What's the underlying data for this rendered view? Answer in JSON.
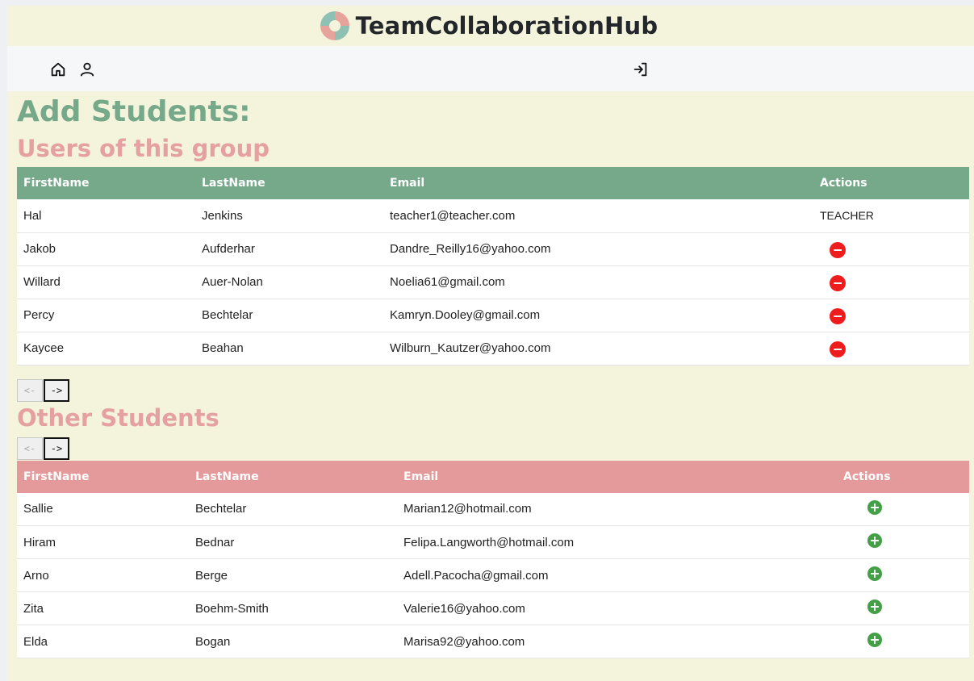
{
  "app": {
    "title": "TeamCollaborationHub"
  },
  "nav": {
    "home_icon": "home-icon",
    "user_icon": "user-icon",
    "login_icon": "login-icon"
  },
  "page": {
    "title": "Add Students:"
  },
  "group": {
    "title": "Users of this group",
    "columns": [
      "FirstName",
      "LastName",
      "Email",
      "Actions"
    ],
    "rows": [
      {
        "first": "Hal",
        "last": "Jenkins",
        "email": "teacher1@teacher.com",
        "action": "TEACHER"
      },
      {
        "first": "Jakob",
        "last": "Aufderhar",
        "email": "Dandre_Reilly16@yahoo.com",
        "action": "remove"
      },
      {
        "first": "Willard",
        "last": "Auer-Nolan",
        "email": "Noelia61@gmail.com",
        "action": "remove"
      },
      {
        "first": "Percy",
        "last": "Bechtelar",
        "email": "Kamryn.Dooley@gmail.com",
        "action": "remove"
      },
      {
        "first": "Kaycee",
        "last": "Beahan",
        "email": "Wilburn_Kautzer@yahoo.com",
        "action": "remove"
      }
    ],
    "pager": {
      "prev": "<-",
      "next": "->"
    }
  },
  "others": {
    "title": "Other Students",
    "columns": [
      "FirstName",
      "LastName",
      "Email",
      "Actions"
    ],
    "rows": [
      {
        "first": "Sallie",
        "last": "Bechtelar",
        "email": "Marian12@hotmail.com",
        "action": "add"
      },
      {
        "first": "Hiram",
        "last": "Bednar",
        "email": "Felipa.Langworth@hotmail.com",
        "action": "add"
      },
      {
        "first": "Arno",
        "last": "Berge",
        "email": "Adell.Pacocha@gmail.com",
        "action": "add"
      },
      {
        "first": "Zita",
        "last": "Boehm-Smith",
        "email": "Valerie16@yahoo.com",
        "action": "add"
      },
      {
        "first": "Elda",
        "last": "Bogan",
        "email": "Marisa92@yahoo.com",
        "action": "add"
      }
    ],
    "pager": {
      "prev": "<-",
      "next": "->"
    }
  },
  "colors": {
    "green_accent": "#76a88a",
    "pink_accent": "#e49a9a",
    "remove_red": "#ee1c1c",
    "add_green": "#43a047",
    "background": "#f4f4dc"
  }
}
